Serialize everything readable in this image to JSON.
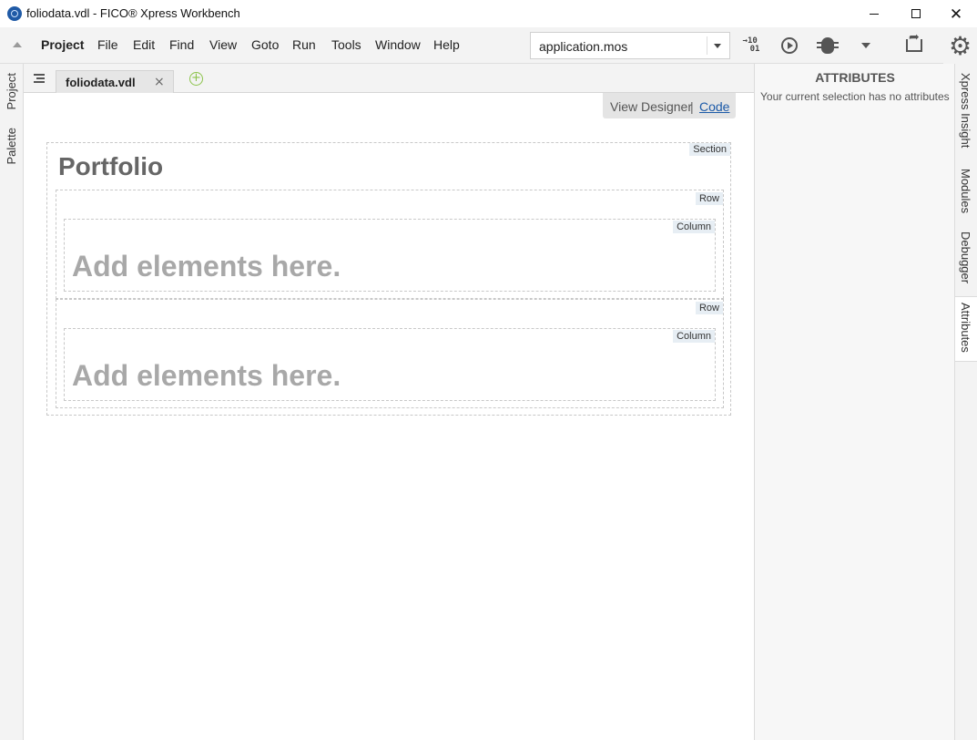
{
  "window": {
    "title": "foliodata.vdl - FICO® Xpress Workbench",
    "minimize": "minimize",
    "maximize": "maximize",
    "close": "✕"
  },
  "menu": {
    "items": [
      "Project",
      "File",
      "Edit",
      "Find",
      "View",
      "Goto",
      "Run",
      "Tools",
      "Window",
      "Help"
    ]
  },
  "toolbar": {
    "run_file": "application.mos",
    "binary_label_top": "→10",
    "binary_label_bottom": "01"
  },
  "sidebar_left": {
    "tabs": [
      "Project",
      "Palette"
    ]
  },
  "editor": {
    "tab_label": "foliodata.vdl",
    "tab_close": "×",
    "new_tab": "+",
    "view_designer": "View Designer",
    "view_separator": "|",
    "view_code": "Code",
    "section_tag": "Section",
    "section_title": "Portfolio",
    "rows": [
      {
        "tag": "Row",
        "column_tag": "Column",
        "placeholder": "Add elements here."
      },
      {
        "tag": "Row",
        "column_tag": "Column",
        "placeholder": "Add elements here."
      }
    ]
  },
  "attributes_panel": {
    "title": "ATTRIBUTES",
    "empty_message": "Your current selection has no attributes"
  },
  "sidebar_right": {
    "tabs": [
      "Xpress Insight",
      "Modules",
      "Debugger",
      "Attributes"
    ],
    "active_tab": "Attributes"
  }
}
